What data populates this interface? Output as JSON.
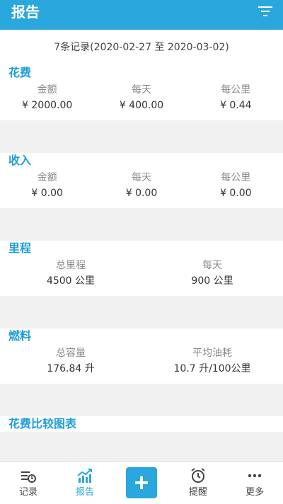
{
  "header": {
    "title": "报告",
    "filter_icon": "filter-icon"
  },
  "summary": "7条记录(2020-02-27 至 2020-03-02)",
  "sections": {
    "expense": {
      "title": "花费",
      "labels": [
        "金额",
        "每天",
        "每公里"
      ],
      "values": [
        "¥ 2000.00",
        "¥ 400.00",
        "¥ 0.44"
      ]
    },
    "income": {
      "title": "收入",
      "labels": [
        "金额",
        "每天",
        "每公里"
      ],
      "values": [
        "¥ 0.00",
        "¥ 0.00",
        "¥ 0.00"
      ]
    },
    "mileage": {
      "title": "里程",
      "labels": [
        "总里程",
        "每天"
      ],
      "values": [
        "4500 公里",
        "900 公里"
      ]
    },
    "fuel": {
      "title": "燃料",
      "labels": [
        "总容量",
        "平均油耗"
      ],
      "values": [
        "176.84 升",
        "10.7 升/100公里"
      ]
    },
    "chart": {
      "title": "花费比较图表"
    }
  },
  "nav": {
    "records": "记录",
    "report": "报告",
    "add_icon": "plus-icon",
    "reminder": "提醒",
    "more": "更多",
    "accent": "#2aa7dd"
  }
}
